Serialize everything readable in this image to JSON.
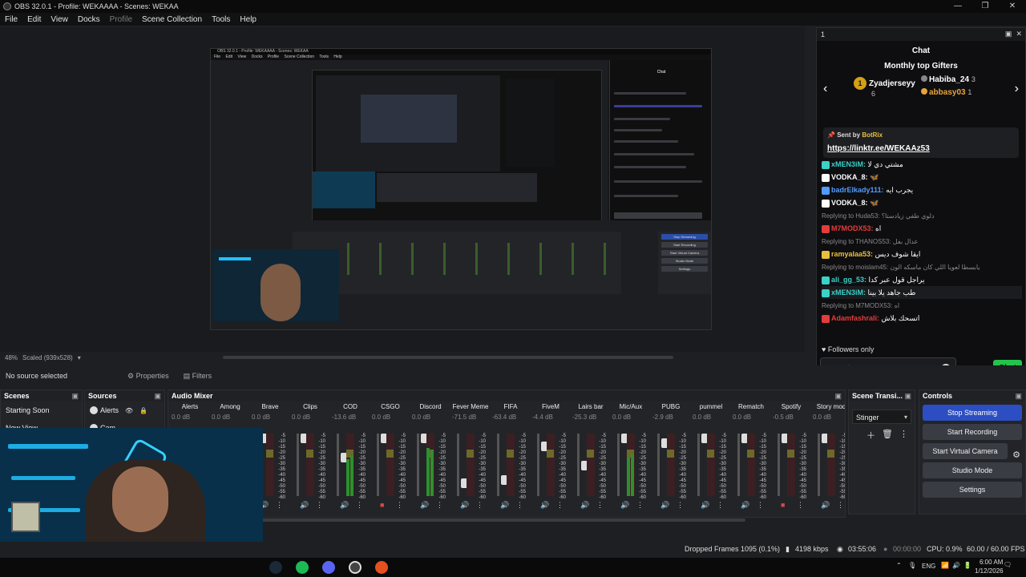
{
  "window": {
    "title": "OBS 32.0.1 - Profile: WEKAAAA - Scenes: WEKAA",
    "minimize": "—",
    "maximize": "❐",
    "close": "✕"
  },
  "menu": [
    "File",
    "Edit",
    "View",
    "Docks",
    "Profile",
    "Scene Collection",
    "Tools",
    "Help"
  ],
  "preview": {
    "zoom": "48%",
    "scale": "Scaled (939x528)",
    "nested_title": "OBS 32.0.1 - Profile: WEKAAAA - Scenes: WEKAA",
    "nested_chat_title": "Chat"
  },
  "nested_menu": [
    "File",
    "Edit",
    "View",
    "Docks",
    "Profile",
    "Scene Collection",
    "Tools",
    "Help"
  ],
  "nested_controls": [
    "Stop Streaming",
    "Start Recording",
    "Start Virtual Camera",
    "Studio Mode",
    "Settings"
  ],
  "chat": {
    "dock_label": "1",
    "title": "Chat",
    "gifters_title": "Monthly top Gifters",
    "gifters": [
      {
        "rank": "1",
        "name": "Zyadjerseyy",
        "count": "6"
      },
      {
        "name": "Habiba_24",
        "count": "3"
      },
      {
        "name": "abbasy03",
        "count": "1"
      }
    ],
    "pinned": {
      "prefix": "Sent by",
      "bot": "BotRix",
      "link": "https://linktr.ee/WEKAAz53"
    },
    "messages": [
      {
        "user": "xMEN3iM:",
        "text": "مشتي دي لا",
        "color": "#3ad1c8"
      },
      {
        "user": "VODKA_8:",
        "text": "🦋",
        "color": "#ffffff"
      },
      {
        "user": "badrElkady111:",
        "text": "يجرب ايه",
        "color": "#4f9bff"
      },
      {
        "user": "VODKA_8:",
        "text": "🦋",
        "color": "#ffffff"
      },
      {
        "reply": "Replying to Huda53: دلوي طفي زيادستا؟"
      },
      {
        "user": "M7MODX53:",
        "text": "اه",
        "color": "#e33c3c"
      },
      {
        "reply": "Replying to THANOS53: عدال بفل"
      },
      {
        "user": "ramyalaa53:",
        "text": "ايقا شوف ديس",
        "color": "#e7c03b"
      },
      {
        "reply": "Replying to moislam45: يابسطا لعويا اللي كان ماسكه الون"
      },
      {
        "user": "ali_gg_53:",
        "text": "يراجل قول عبر كدا",
        "color": "#3ad1c8"
      },
      {
        "user": "xMEN3iM:",
        "text": "طب جاهد يلا بينا",
        "color": "#3ad1c8"
      },
      {
        "reply": "Replying to M7MODX53: اه"
      },
      {
        "user": "Adamfashrali:",
        "text": "اتسحك بلاش",
        "color": "#e33c3c"
      }
    ],
    "followers_only": "Followers only",
    "input_placeholder": "Send a message",
    "chat_button": "Chat"
  },
  "source_bar": {
    "no_source": "No source selected",
    "properties": "Properties",
    "filters": "Filters"
  },
  "scenes": {
    "title": "Scenes",
    "items": [
      "Starting Soon",
      "New View"
    ]
  },
  "sources": {
    "title": "Sources",
    "items": [
      "Alerts",
      "Cam"
    ]
  },
  "mixer": {
    "title": "Audio Mixer",
    "channels": [
      {
        "name": "Alerts",
        "db": "0.0 dB",
        "mute": false
      },
      {
        "name": "Among",
        "db": "0.0 dB",
        "mute": false
      },
      {
        "name": "Brave",
        "db": "0.0 dB",
        "mute": false
      },
      {
        "name": "Clips",
        "db": "0.0 dB",
        "mute": false
      },
      {
        "name": "COD",
        "db": "-13.6 dB",
        "mute": false
      },
      {
        "name": "CSGO",
        "db": "0.0 dB",
        "mute": true
      },
      {
        "name": "Discord",
        "db": "0.0 dB",
        "mute": false
      },
      {
        "name": "Fever Meme",
        "db": "-71.5 dB",
        "mute": false
      },
      {
        "name": "FIFA",
        "db": "-63.4 dB",
        "mute": false
      },
      {
        "name": "FiveM",
        "db": "-4.4 dB",
        "mute": false
      },
      {
        "name": "Lairs bar",
        "db": "-25.3 dB",
        "mute": false
      },
      {
        "name": "Mic/Aux",
        "db": "0.0 dB",
        "mute": false
      },
      {
        "name": "PUBG",
        "db": "-2.9 dB",
        "mute": false
      },
      {
        "name": "pummel",
        "db": "0.0 dB",
        "mute": false
      },
      {
        "name": "Rematch",
        "db": "0.0 dB",
        "mute": false
      },
      {
        "name": "Spotify",
        "db": "-0.5 dB",
        "mute": true
      },
      {
        "name": "Story mod",
        "db": "0.0 dB",
        "mute": false
      }
    ],
    "scale": [
      "-5",
      "-10",
      "-15",
      "-20",
      "-25",
      "-30",
      "-35",
      "-40",
      "-45",
      "-50",
      "-55",
      "-60"
    ]
  },
  "transitions": {
    "title": "Scene Transi...",
    "selected": "Stinger"
  },
  "controls": {
    "title": "Controls",
    "stop_streaming": "Stop Streaming",
    "start_recording": "Start Recording",
    "start_virtual_camera": "Start Virtual Camera",
    "studio_mode": "Studio Mode",
    "settings": "Settings"
  },
  "status": {
    "dropped": "Dropped Frames 1095 (0.1%)",
    "kbps": "4198 kbps",
    "stream_time": "03:55:06",
    "rec_time": "00:00:00",
    "cpu": "CPU: 0.9%",
    "fps": "60.00 / 60.00 FPS"
  },
  "taskbar": {
    "lang": "ENG",
    "time": "6:00 AM",
    "date": "1/12/2026"
  },
  "colors": {
    "accent": "#2c4ec2",
    "chat_green": "#23c44a",
    "gold": "#d4a017"
  }
}
